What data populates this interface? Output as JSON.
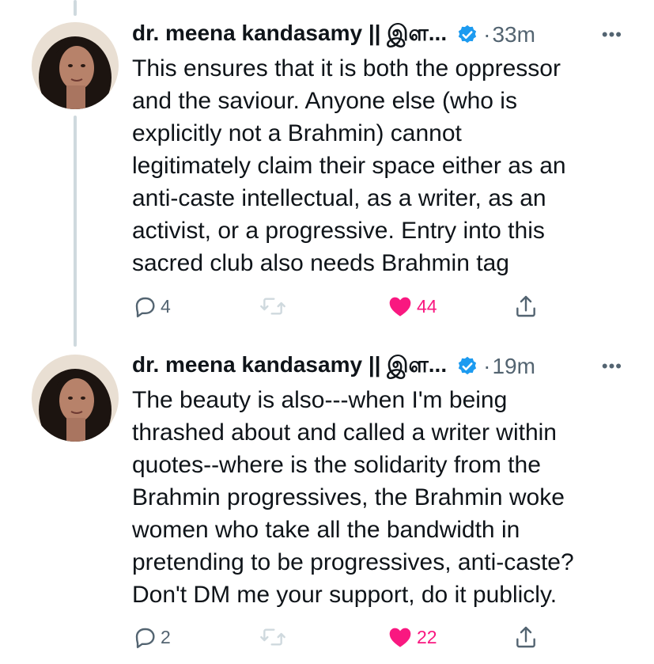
{
  "tweets": [
    {
      "author": "dr. meena kandasamy || இள...",
      "time": "33m",
      "more": "•••",
      "text": "This ensures that it is both the oppressor\nand the saviour. Anyone else (who is\nexplicitly not a Brahmin) cannot\nlegitimately claim their space either as an\nanti-caste intellectual, as a writer, as an\nactivist, or a progressive. Entry into this\nsacred club also needs Brahmin tag",
      "replies": "4",
      "likes": "44"
    },
    {
      "author": "dr. meena kandasamy || இள...",
      "time": "19m",
      "more": "•••",
      "text": "The beauty is also---when I'm being\nthrashed about and called a writer within\nquotes--where is the solidarity from the\nBrahmin progressives, the Brahmin woke\nwomen who take all the bandwidth in\npretending to be progressives, anti-caste?\nDon't DM me your support, do it publicly.",
      "replies": "2",
      "likes": "22"
    }
  ],
  "separator": "·",
  "colors": {
    "text": "#0f1419",
    "secondary": "#536471",
    "verified": "#1d9bf0",
    "like": "#f91880",
    "thread_line": "#cfd9de"
  },
  "icons": [
    "reply-icon",
    "retweet-icon",
    "like-icon",
    "share-icon",
    "verified-icon",
    "more-icon"
  ]
}
